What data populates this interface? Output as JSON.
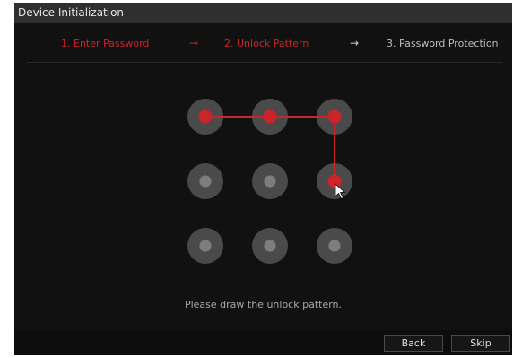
{
  "window": {
    "title": "Device Initialization"
  },
  "steps": [
    {
      "label": "1.  Enter Password",
      "state": "done"
    },
    {
      "label": "2.  Unlock Pattern",
      "state": "current"
    },
    {
      "label": "3.  Password Protection",
      "state": "pending"
    }
  ],
  "step_arrow": "→",
  "pattern": {
    "rows": 3,
    "cols": 3,
    "selected_sequence": [
      1,
      2,
      3,
      6
    ],
    "prompt": "Please draw the unlock pattern."
  },
  "buttons": {
    "back": "Back",
    "skip": "Skip"
  },
  "colors": {
    "accent": "#c9252b",
    "dot_ring": "#4a4a4a",
    "dot_center": "#7d7d7d",
    "background": "#111111"
  }
}
